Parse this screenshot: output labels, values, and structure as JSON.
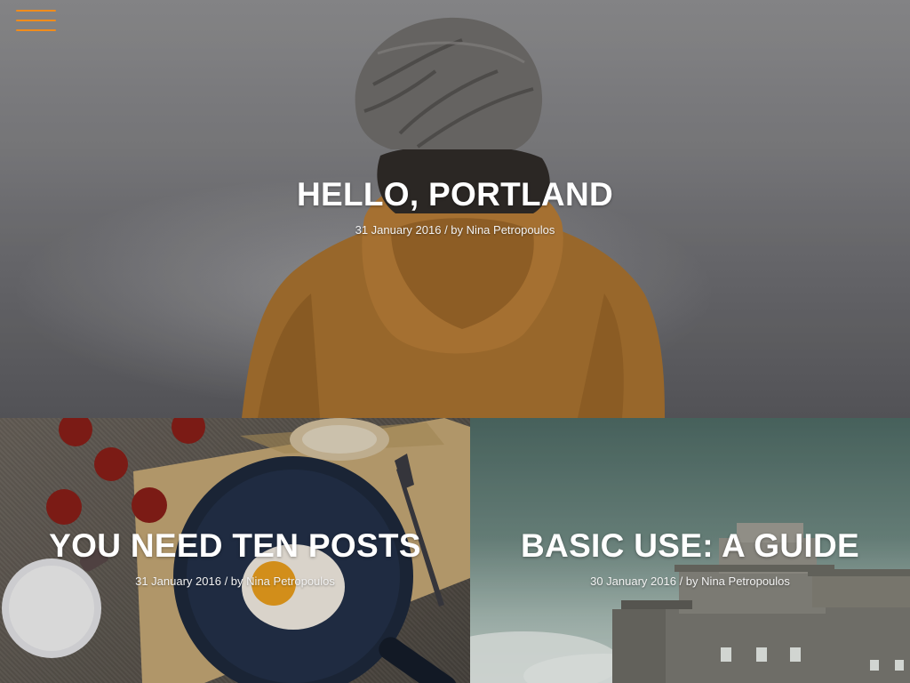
{
  "menu": {
    "icon": "hamburger-menu-icon",
    "color": "#f08c1c"
  },
  "posts": [
    {
      "title": "HELLO, PORTLAND",
      "date": "31 January 2016",
      "separator": "/ by",
      "author": "Nina Petropoulos"
    },
    {
      "title": "YOU NEED TEN POSTS",
      "date": "31 January 2016",
      "separator": "/ by",
      "author": "Nina Petropoulos"
    },
    {
      "title": "BASIC USE: A GUIDE",
      "date": "30 January 2016",
      "separator": "/ by",
      "author": "Nina Petropoulos"
    }
  ]
}
